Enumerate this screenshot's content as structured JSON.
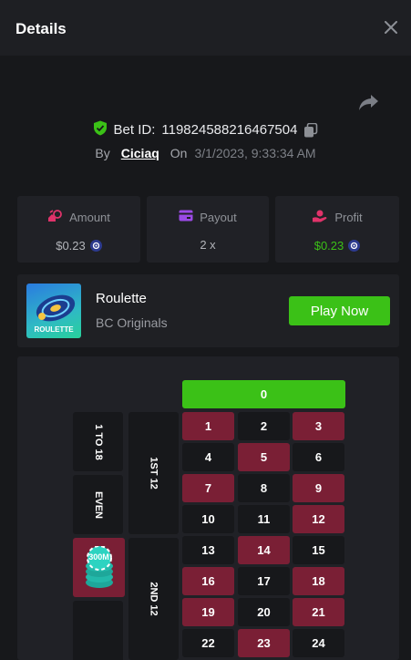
{
  "header": {
    "title": "Details"
  },
  "bet": {
    "id_label": "Bet ID:",
    "id_value": "119824588216467504",
    "by_label": "By",
    "username": "Ciciaq",
    "on_label": "On",
    "datetime": "3/1/2023, 9:33:34 AM"
  },
  "stats": {
    "amount": {
      "label": "Amount",
      "value": "$0.23"
    },
    "payout": {
      "label": "Payout",
      "value": "2 x"
    },
    "profit": {
      "label": "Profit",
      "value": "$0.23"
    }
  },
  "game": {
    "name": "Roulette",
    "provider": "BC Originals",
    "thumb_text": "ROULETTE",
    "play_label": "Play Now"
  },
  "roulette": {
    "zero": "0",
    "numbers": [
      {
        "n": "1",
        "c": "red"
      },
      {
        "n": "2",
        "c": "black"
      },
      {
        "n": "3",
        "c": "red"
      },
      {
        "n": "4",
        "c": "black"
      },
      {
        "n": "5",
        "c": "red"
      },
      {
        "n": "6",
        "c": "black"
      },
      {
        "n": "7",
        "c": "red"
      },
      {
        "n": "8",
        "c": "black"
      },
      {
        "n": "9",
        "c": "red"
      },
      {
        "n": "10",
        "c": "black"
      },
      {
        "n": "11",
        "c": "black"
      },
      {
        "n": "12",
        "c": "red"
      },
      {
        "n": "13",
        "c": "black"
      },
      {
        "n": "14",
        "c": "red"
      },
      {
        "n": "15",
        "c": "black"
      },
      {
        "n": "16",
        "c": "red"
      },
      {
        "n": "17",
        "c": "black"
      },
      {
        "n": "18",
        "c": "red"
      },
      {
        "n": "19",
        "c": "red"
      },
      {
        "n": "20",
        "c": "black"
      },
      {
        "n": "21",
        "c": "red"
      },
      {
        "n": "22",
        "c": "black"
      },
      {
        "n": "23",
        "c": "red"
      },
      {
        "n": "24",
        "c": "black"
      }
    ],
    "dozens": [
      "1ST 12",
      "2ND 12"
    ],
    "outside": [
      "1 TO 18",
      "EVEN"
    ],
    "chip_label": "300M"
  },
  "colors": {
    "green": "#3bc117",
    "red": "#7a1f35",
    "black": "#17181b",
    "panel": "#202126"
  },
  "icons": {
    "close": "close-icon",
    "share": "share-icon",
    "verified": "shield-check-icon",
    "copy": "copy-icon",
    "amount": "amount-icon",
    "payout": "card-icon",
    "profit": "hand-coin-icon",
    "coin": "coin-icon"
  }
}
